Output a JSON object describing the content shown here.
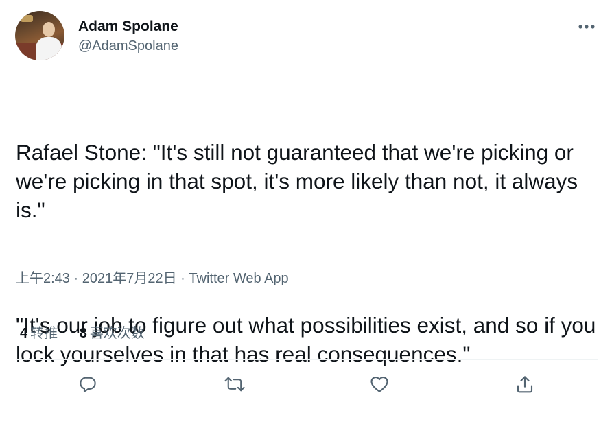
{
  "author": {
    "display_name": "Adam Spolane",
    "handle": "@AdamSpolane",
    "avatar_icon": "profile-photo"
  },
  "tweet": {
    "paragraphs": [
      "Rafael Stone: \"It's still not guaranteed that we're picking or we're picking in that spot, it's more likely than not, it always is.\"",
      "\"It's our job to figure out what possibilities exist, and so if you lock yourselves in that has real consequences.\""
    ],
    "time": "上午2:43",
    "date": "2021年7月22日",
    "separator": "·",
    "source": "Twitter Web App"
  },
  "stats": {
    "retweets_count": "4",
    "retweets_label": "转推",
    "likes_count": "8",
    "likes_label": "喜欢次数"
  },
  "actions": [
    "reply-icon",
    "retweet-icon",
    "like-icon",
    "share-icon"
  ],
  "colors": {
    "text": "#0f1419",
    "secondary": "#536471",
    "divider": "#eff3f4"
  }
}
